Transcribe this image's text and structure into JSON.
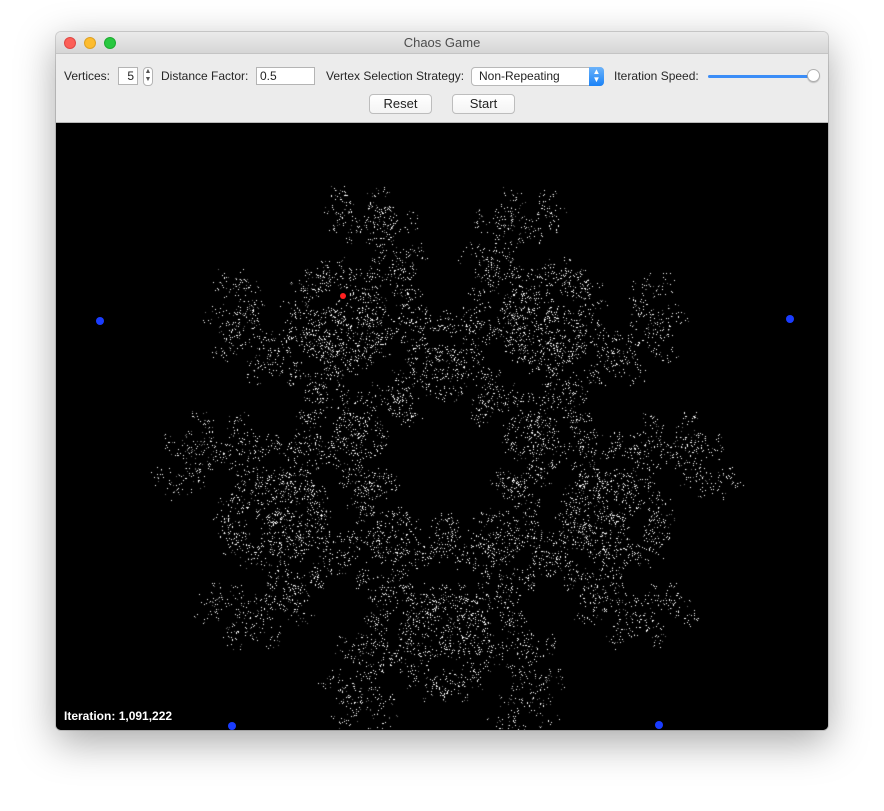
{
  "window": {
    "title": "Chaos Game"
  },
  "toolbar": {
    "vertices_label": "Vertices:",
    "vertices_value": "5",
    "distance_label": "Distance Factor:",
    "distance_value": "0.5",
    "strategy_label": "Vertex Selection Strategy:",
    "strategy_value": "Non-Repeating",
    "speed_label": "Iteration Speed:",
    "speed_value": 1.0,
    "reset_label": "Reset",
    "start_label": "Start"
  },
  "canvas": {
    "iteration_label": "Iteration:",
    "iteration_value": "1,091,222",
    "vertex_color": "#1a3cff",
    "current_point_color": "#ff2020",
    "fractal_color": "#e8e8e8",
    "background": "#000000"
  }
}
